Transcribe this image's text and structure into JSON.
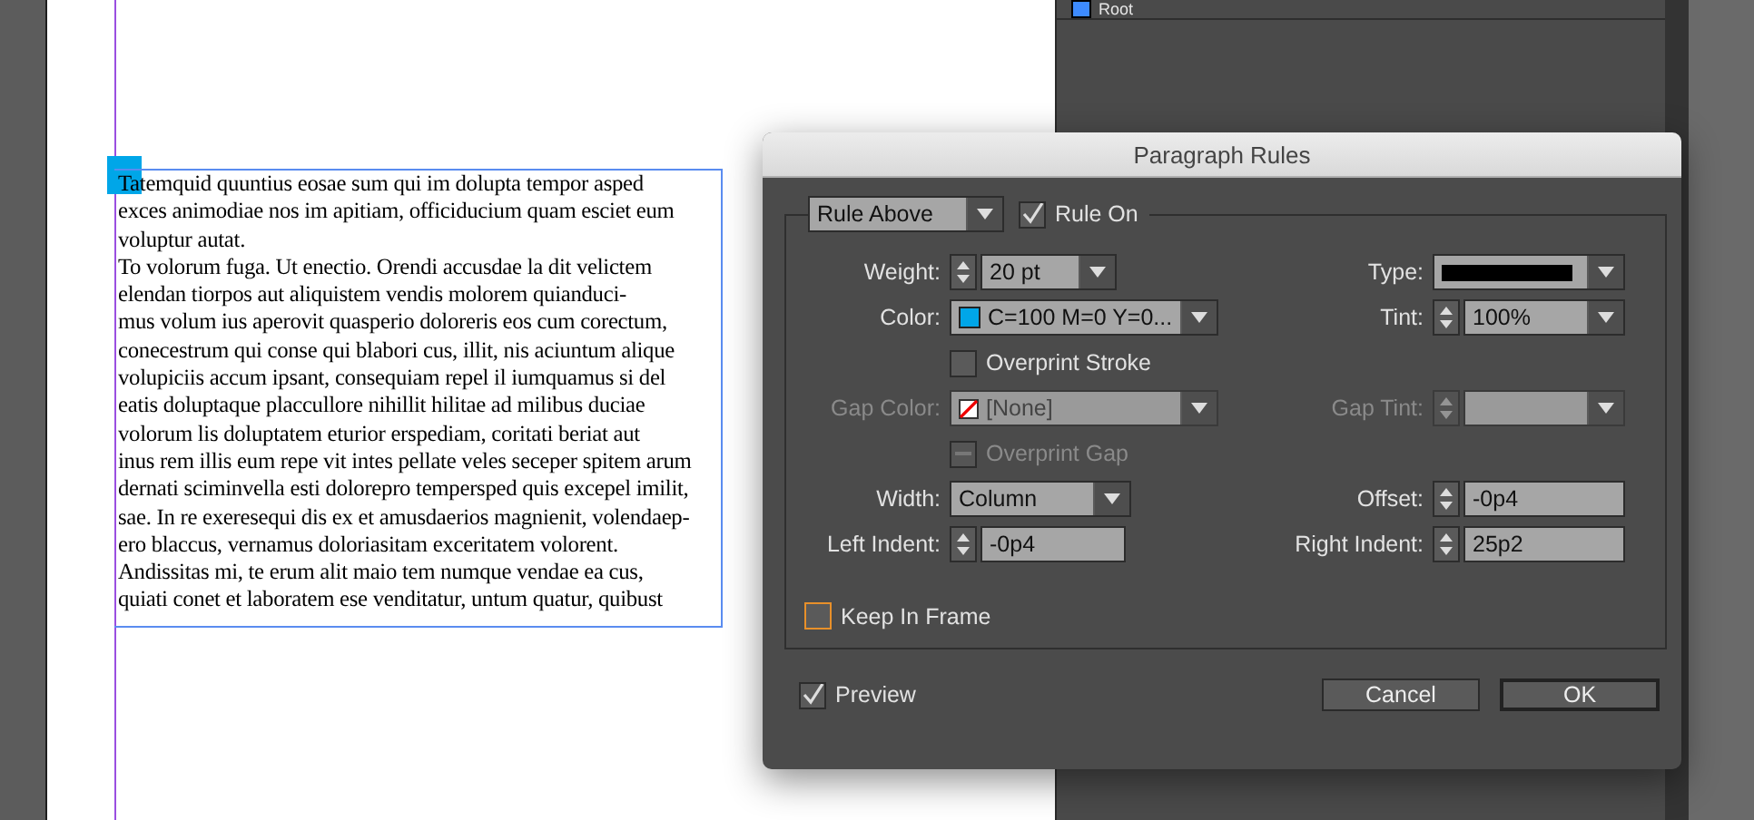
{
  "document": {
    "paragraphs": [
      [
        "Tatemquid quuntius eosae sum qui im dolupta tempor asped",
        "exces animodiae nos im apitiam, officiducium quam esciet eum",
        "voluptur autat."
      ],
      [
        "To volorum fuga. Ut enectio. Orendi accusdae la dit velictem",
        "elendan tiorpos aut aliquistem vendis molorem quianduci-",
        "mus volum ius aperovit quasperio doloreris eos cum corectum,",
        "conecestrum qui conse qui blabori cus, illit, nis aciuntum alique",
        "volupiciis accum ipsant, consequiam repel il iumquamus si del",
        "eatis doluptaque placcullore nihillit hilitae ad milibus duciae",
        "volorum lis doluptatem eturior erspediam, coritati beriat aut",
        "inus rem illis eum repe vit intes pellate veles seceper spitem arum",
        "dernati sciminvella esti dolorepro tempersped quis excepel imilit,",
        "sae. In re exeresequi dis ex et amusdaerios magnienit, volendaep-",
        "ero blaccus, vernamus doloriasitam exceritatem volorent.",
        "Andissitas mi, te erum alit maio tem numque vendae ea cus,",
        "quiati conet et laboratem ese venditatur, untum quatur, quibust"
      ]
    ]
  },
  "layers_panel": {
    "items": [
      {
        "label": "Root"
      }
    ]
  },
  "dialog": {
    "title": "Paragraph Rules",
    "rule_select": {
      "value": "Rule Above"
    },
    "rule_on": {
      "label": "Rule On",
      "checked": true
    },
    "weight": {
      "label": "Weight:",
      "value": "20 pt"
    },
    "type": {
      "label": "Type:"
    },
    "color": {
      "label": "Color:",
      "value": "C=100 M=0 Y=0...",
      "color": "#00a6e8"
    },
    "tint": {
      "label": "Tint:",
      "value": "100%"
    },
    "overprint_stroke": {
      "label": "Overprint Stroke",
      "checked": false,
      "disabled": false
    },
    "gap_color": {
      "label": "Gap Color:",
      "value": "[None]",
      "disabled": true
    },
    "gap_tint": {
      "label": "Gap Tint:",
      "disabled": true
    },
    "overprint_gap": {
      "label": "Overprint Gap",
      "checked": false,
      "disabled": true
    },
    "width": {
      "label": "Width:",
      "value": "Column"
    },
    "offset": {
      "label": "Offset:",
      "value": "-0p4"
    },
    "left_indent": {
      "label": "Left Indent:",
      "value": "-0p4"
    },
    "right_indent": {
      "label": "Right Indent:",
      "value": "25p2"
    },
    "keep_in_frame": {
      "label": "Keep In Frame",
      "checked": false,
      "focused": true
    },
    "preview": {
      "label": "Preview",
      "checked": true
    },
    "buttons": [
      {
        "label": "Cancel",
        "kind": "secondary"
      },
      {
        "label": "OK",
        "kind": "default"
      }
    ]
  }
}
